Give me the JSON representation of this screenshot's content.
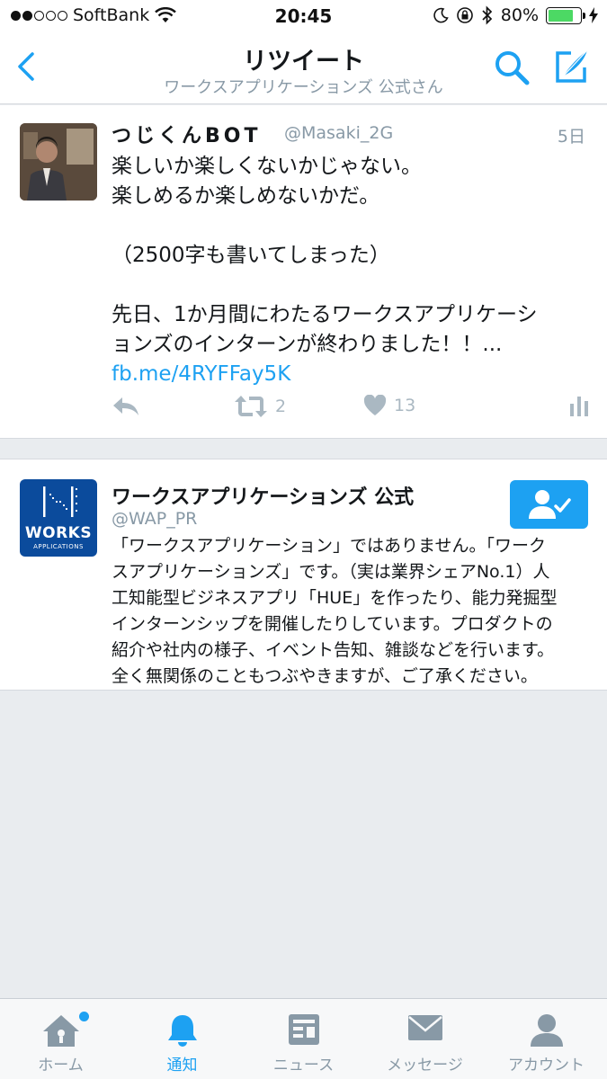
{
  "status_bar": {
    "carrier": "SoftBank",
    "time": "20:45",
    "battery_percent": "80%",
    "battery_level": 0.8,
    "signal_bars_filled": 2,
    "signal_bars_total": 5
  },
  "nav": {
    "title": "リツイート",
    "subtitle": "ワークスアプリケーションズ 公式さん"
  },
  "tweet": {
    "author_name": "つじくんBOT",
    "author_handle": "@Masaki_2G",
    "time": "5日",
    "line1": "楽しいか楽しくないかじゃない。",
    "line2": "楽しめるか楽しめないかだ。",
    "line3": "（2500字も書いてしまった）",
    "line4": "先日、1か月間にわたるワークスアプリケーシ",
    "line5": "ョンズのインターンが終わりました！！...",
    "link": "fb.me/4RYFFay5K",
    "retweet_count": "2",
    "like_count": "13"
  },
  "user_card": {
    "name": "ワークスアプリケーションズ 公式",
    "handle": "@WAP_PR",
    "avatar_text": "WORKS",
    "avatar_subtext": "APPLICATIONS",
    "bio_line1": "「ワークスアプリケーション」ではありません。「ワーク",
    "bio_line2": "スアプリケーションズ」です。（実は業界シェアNo.1）人",
    "bio_line3": "工知能型ビジネスアプリ「HUE」を作ったり、能力発掘型",
    "bio_line4": "インターンシップを開催したりしています。プロダクトの",
    "bio_line5": "紹介や社内の様子、イベント告知、雑談などを行います。",
    "bio_line6": "全く無関係のこともつぶやきますが、ご了承ください。"
  },
  "tabs": {
    "home": "ホーム",
    "notifications": "通知",
    "news": "ニュース",
    "messages": "メッセージ",
    "account": "アカウント"
  },
  "colors": {
    "accent": "#1da1f2",
    "muted": "#8899a6",
    "works_blue": "#0b4b9c"
  }
}
